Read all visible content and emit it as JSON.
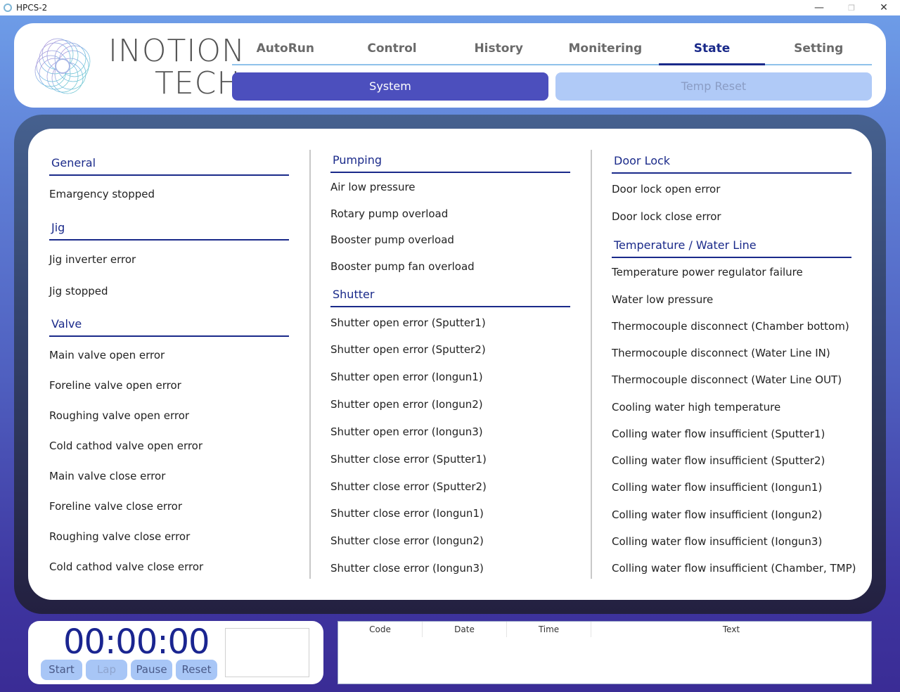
{
  "window": {
    "title": "HPCS-2",
    "minimize": "—",
    "restore": "❐",
    "close": "✕"
  },
  "logo": {
    "line1": "INOTION",
    "line2": "TECH"
  },
  "tabs": [
    "AutoRun",
    "Control",
    "History",
    "Monitering",
    "State",
    "Setting"
  ],
  "active_tab": "State",
  "subtabs": {
    "system": "System",
    "temp_reset": "Temp Reset"
  },
  "general": {
    "title": "General",
    "items": [
      "Emargency stopped"
    ]
  },
  "jig": {
    "title": "Jig",
    "items": [
      "Jig inverter error",
      "Jig stopped"
    ]
  },
  "valve": {
    "title": "Valve",
    "items": [
      "Main valve open error",
      "Foreline valve open error",
      "Roughing valve open error",
      "Cold cathod valve open error",
      "Main valve close error",
      "Foreline valve close error",
      "Roughing valve close error",
      "Cold cathod valve close error"
    ]
  },
  "pumping": {
    "title": "Pumping",
    "items": [
      "Air low pressure",
      "Rotary pump overload",
      "Booster pump overload",
      "Booster pump fan overload"
    ]
  },
  "shutter": {
    "title": "Shutter",
    "items": [
      "Shutter open error (Sputter1)",
      "Shutter open error (Sputter2)",
      "Shutter open error (Iongun1)",
      "Shutter open error (Iongun2)",
      "Shutter open error (Iongun3)",
      "Shutter close error (Sputter1)",
      "Shutter close error (Sputter2)",
      "Shutter close error (Iongun1)",
      "Shutter close error (Iongun2)",
      "Shutter close error (Iongun3)"
    ]
  },
  "door_lock": {
    "title": "Door Lock",
    "items": [
      "Door lock open error",
      "Door lock close error"
    ]
  },
  "temperature": {
    "title": "Temperature / Water Line",
    "items": [
      "Temperature power regulator failure",
      "Water low pressure",
      "Thermocouple disconnect (Chamber bottom)",
      "Thermocouple disconnect (Water Line IN)",
      "Thermocouple disconnect (Water Line OUT)",
      "Cooling water high temperature",
      "Colling water flow insufficient (Sputter1)",
      "Colling water flow insufficient (Sputter2)",
      "Colling water flow insufficient (Iongun1)",
      "Colling water flow insufficient (Iongun2)",
      "Colling water flow insufficient (Iongun3)",
      "Colling water flow insufficient (Chamber, TMP)"
    ]
  },
  "timer": {
    "display": "00:00:00",
    "start": "Start",
    "lap": "Lap",
    "pause": "Pause",
    "reset": "Reset"
  },
  "log": {
    "columns": [
      "Code",
      "Date",
      "Time",
      "Text"
    ]
  },
  "colors": {
    "accent": "#1a2a8a",
    "system_button": "#4c4fbd",
    "temp_button": "#b0caf7"
  }
}
